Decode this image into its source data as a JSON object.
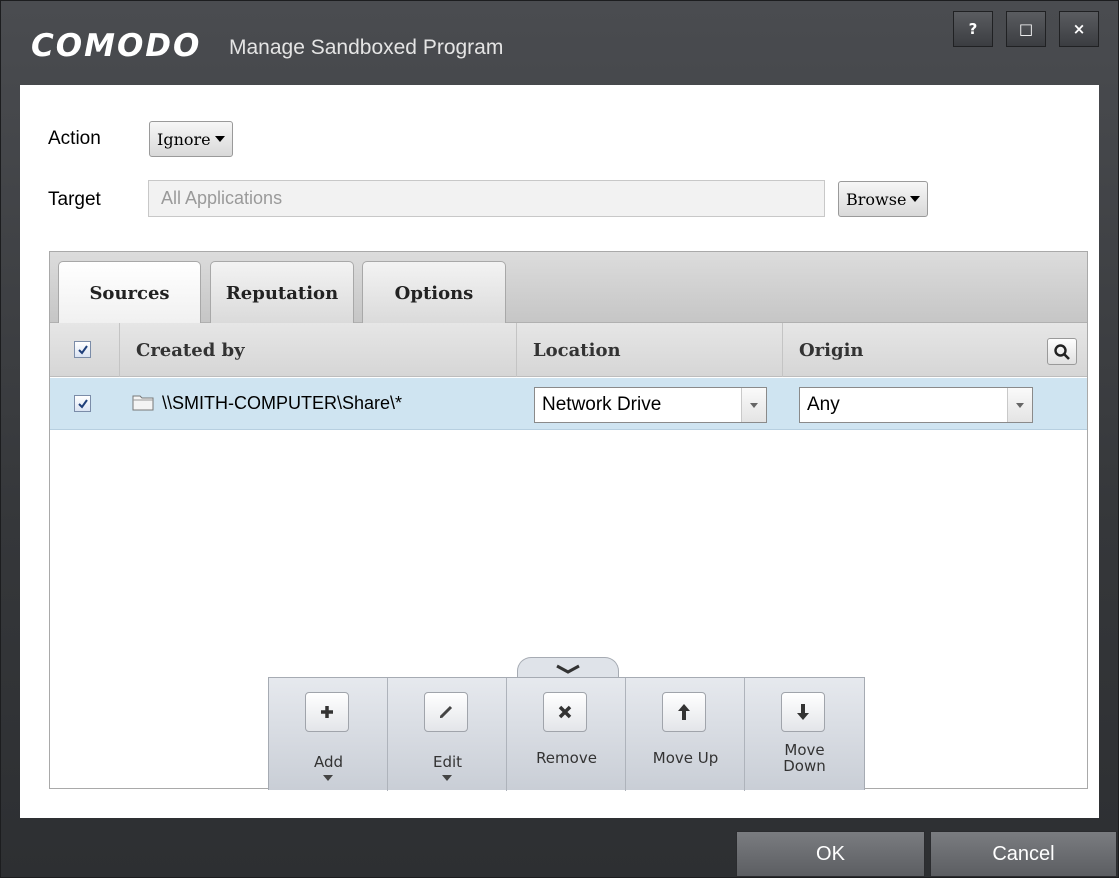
{
  "window": {
    "brand": "COMODO",
    "title": "Manage Sandboxed Program",
    "controls": {
      "help": "?",
      "maximize": "□",
      "close": "×"
    }
  },
  "form": {
    "action_label": "Action",
    "action_value": "Ignore",
    "target_label": "Target",
    "target_placeholder": "All Applications",
    "browse_label": "Browse"
  },
  "tabs": [
    {
      "label": "Sources",
      "active": true
    },
    {
      "label": "Reputation",
      "active": false
    },
    {
      "label": "Options",
      "active": false
    }
  ],
  "table": {
    "columns": [
      "Created by",
      "Location",
      "Origin"
    ],
    "header_checked": true,
    "rows": [
      {
        "checked": true,
        "created_by": "\\\\SMITH-COMPUTER\\Share\\*",
        "location": "Network Drive",
        "origin": "Any",
        "icon": "folder-icon"
      }
    ]
  },
  "toolbar": {
    "add": "Add",
    "edit": "Edit",
    "remove": "Remove",
    "move_up": "Move Up",
    "move_down_line1": "Move",
    "move_down_line2": "Down"
  },
  "footer": {
    "ok": "OK",
    "cancel": "Cancel"
  }
}
